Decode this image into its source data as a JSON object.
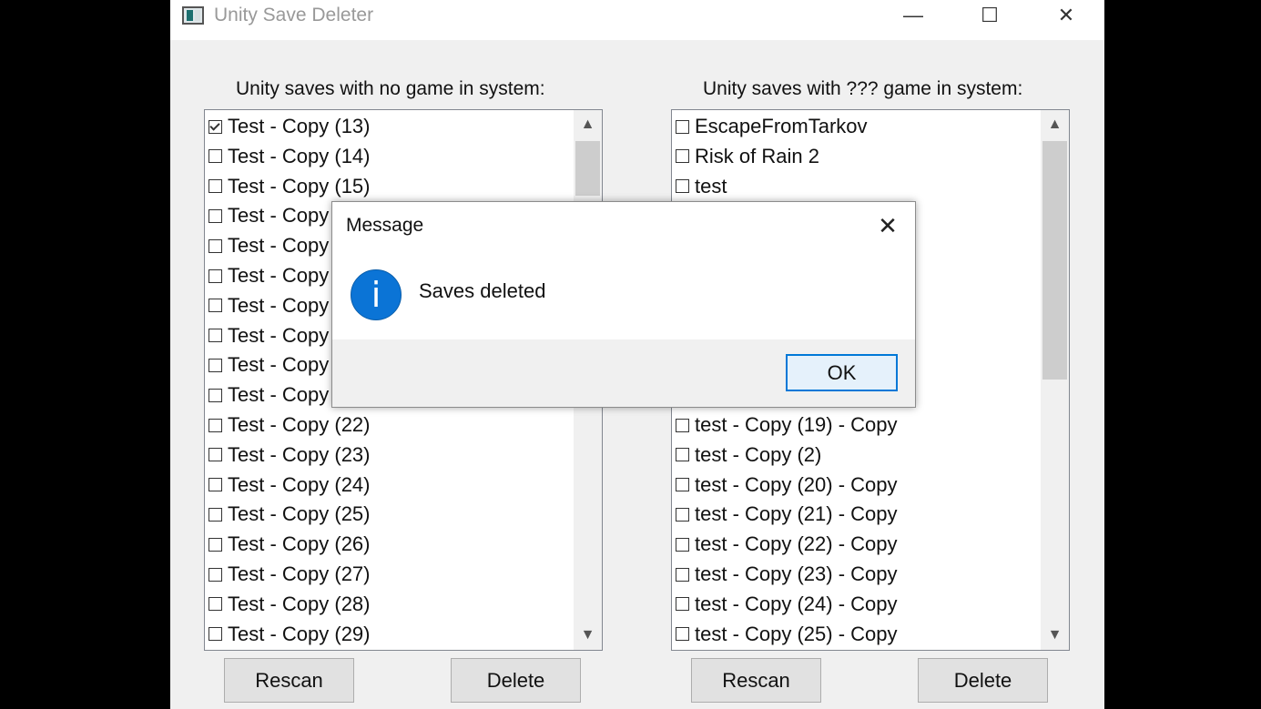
{
  "window": {
    "title": "Unity Save Deleter",
    "controls": {
      "minimize": "—",
      "maximize": "☐",
      "close": "✕"
    }
  },
  "left_panel": {
    "heading": "Unity saves with no game in system:",
    "items": [
      {
        "label": "Test - Copy (13)",
        "checked": true
      },
      {
        "label": "Test - Copy (14)",
        "checked": false
      },
      {
        "label": "Test - Copy (15)",
        "checked": false
      },
      {
        "label": "Test - Copy",
        "checked": false
      },
      {
        "label": "Test - Copy",
        "checked": false
      },
      {
        "label": "Test - Copy",
        "checked": false
      },
      {
        "label": "Test - Copy",
        "checked": false
      },
      {
        "label": "Test - Copy",
        "checked": false
      },
      {
        "label": "Test - Copy",
        "checked": false
      },
      {
        "label": "Test - Copy",
        "checked": false
      },
      {
        "label": "Test - Copy (22)",
        "checked": false
      },
      {
        "label": "Test - Copy (23)",
        "checked": false
      },
      {
        "label": "Test - Copy (24)",
        "checked": false
      },
      {
        "label": "Test - Copy (25)",
        "checked": false
      },
      {
        "label": "Test - Copy (26)",
        "checked": false
      },
      {
        "label": "Test - Copy (27)",
        "checked": false
      },
      {
        "label": "Test - Copy (28)",
        "checked": false
      },
      {
        "label": "Test - Copy (29)",
        "checked": false
      }
    ],
    "scroll": {
      "up_arrow": "▲",
      "down_arrow": "▼"
    },
    "rescan_label": "Rescan",
    "delete_label": "Delete"
  },
  "right_panel": {
    "heading": "Unity saves with ??? game in system:",
    "items": [
      {
        "label": "EscapeFromTarkov",
        "checked": false
      },
      {
        "label": "Risk of Rain 2",
        "checked": false
      },
      {
        "label": "test",
        "checked": false
      },
      {
        "label": "",
        "checked": false
      },
      {
        "label": "",
        "checked": false
      },
      {
        "label": "",
        "checked": false
      },
      {
        "label": "",
        "checked": false
      },
      {
        "label": "",
        "checked": false
      },
      {
        "label": "",
        "checked": false
      },
      {
        "label": "",
        "checked": false
      },
      {
        "label": "test - Copy (19) - Copy",
        "checked": false
      },
      {
        "label": "test - Copy (2)",
        "checked": false
      },
      {
        "label": "test - Copy (20) - Copy",
        "checked": false
      },
      {
        "label": "test - Copy (21) - Copy",
        "checked": false
      },
      {
        "label": "test - Copy (22) - Copy",
        "checked": false
      },
      {
        "label": "test - Copy (23) - Copy",
        "checked": false
      },
      {
        "label": "test - Copy (24) - Copy",
        "checked": false
      },
      {
        "label": "test - Copy (25) - Copy",
        "checked": false
      }
    ],
    "scroll": {
      "up_arrow": "▲",
      "down_arrow": "▼"
    },
    "rescan_label": "Rescan",
    "delete_label": "Delete"
  },
  "dialog": {
    "title": "Message",
    "close": "✕",
    "icon": "info-icon",
    "icon_glyph": "i",
    "message": "Saves deleted",
    "ok_label": "OK",
    "accent_color": "#0078d7"
  }
}
